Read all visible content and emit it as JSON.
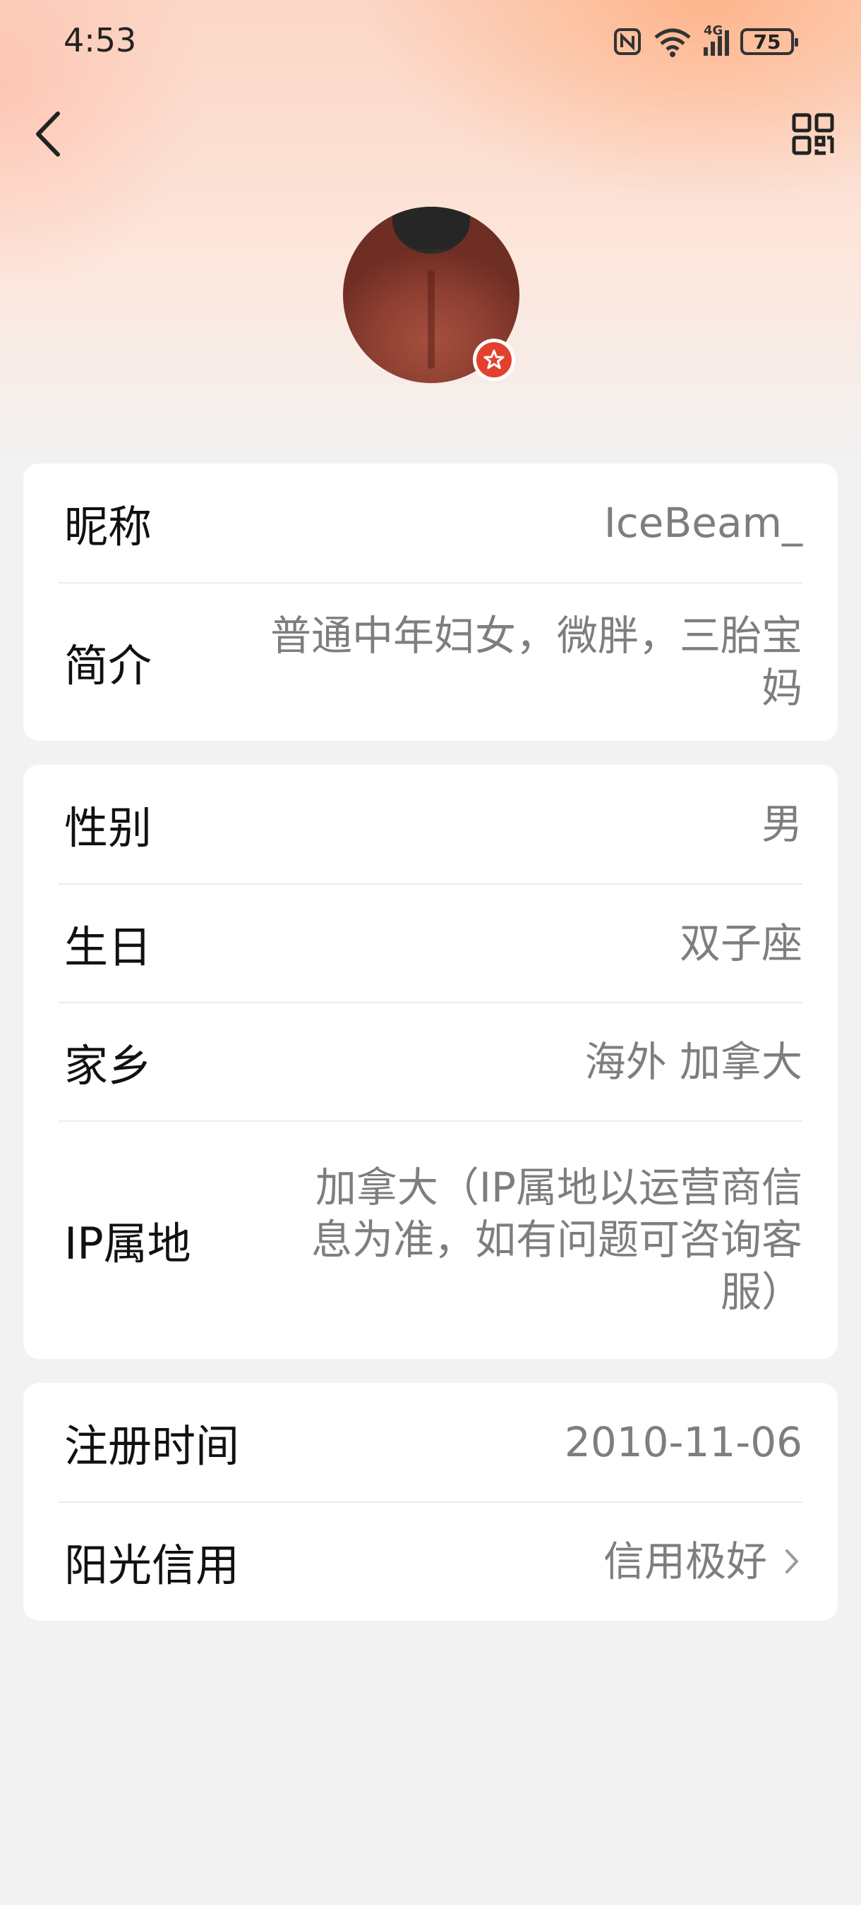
{
  "status_bar": {
    "time": "4:53",
    "battery": "75",
    "network": "4G"
  },
  "header": {
    "back_icon": "chevron-left-icon",
    "qr_icon": "qr-code-icon"
  },
  "profile": {
    "nickname_label": "昵称",
    "nickname": "IceBeam_",
    "bio_label": "简介",
    "bio": "普通中年妇女，微胖，三胎宝妈",
    "gender_label": "性别",
    "gender": "男",
    "birthday_label": "生日",
    "birthday": "双子座",
    "hometown_label": "家乡",
    "hometown": "海外 加拿大",
    "ip_label": "IP属地",
    "ip": "加拿大（IP属地以运营商信息为准，如有问题可咨询客服）",
    "register_label": "注册时间",
    "register_date": "2010-11-06",
    "credit_label": "阳光信用",
    "credit": "信用极好"
  },
  "colors": {
    "badge": "#e5402f",
    "label": "#111111",
    "value": "#7e7e7e",
    "background": "#f2f2f2"
  }
}
